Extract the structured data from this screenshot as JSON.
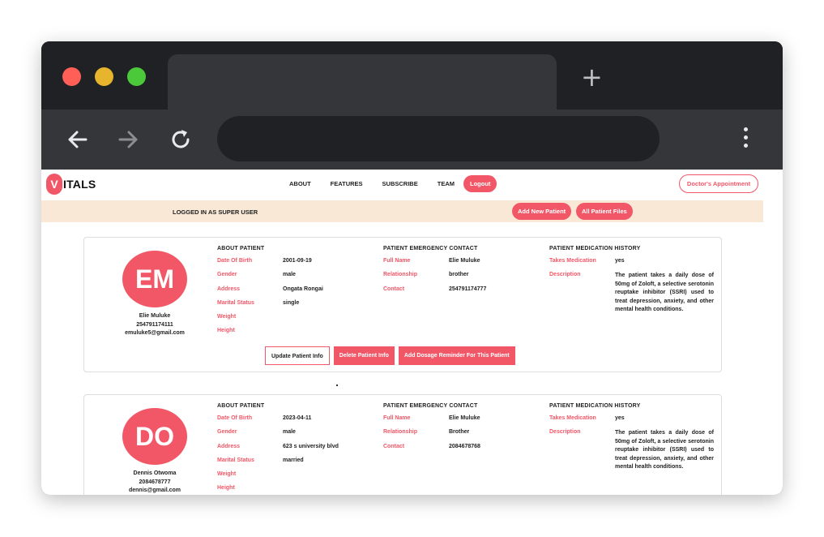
{
  "browser": {
    "new_tab_symbol": "+",
    "icons": [
      "back-arrow-icon",
      "forward-arrow-icon",
      "reload-icon",
      "more-vertical-icon"
    ]
  },
  "site": {
    "logo_initial": "V",
    "logo_rest": "ITALS",
    "nav": [
      "ABOUT",
      "FEATURES",
      "SUBSCRIBE",
      "TEAM"
    ],
    "logout_label": "Logout",
    "appointment_label": "Doctor's Appointment",
    "accent_color": "#f25767"
  },
  "admin_bar": {
    "status": "LOGGED IN AS SUPER USER",
    "add_patient_label": "Add New Patient",
    "all_files_label": "All Patient Files"
  },
  "headings": {
    "about": "ABOUT PATIENT",
    "emergency": "PATIENT EMERGENCY CONTACT",
    "medication": "PATIENT MEDICATION HISTORY"
  },
  "labels": {
    "dob": "Date Of Birth",
    "gender": "Gender",
    "address": "Address",
    "marital": "Marital Status",
    "weight": "Weight",
    "height": "Height",
    "full_name": "Full Name",
    "relationship": "Relationship",
    "contact": "Contact",
    "takes_med": "Takes Medication",
    "description": "Description"
  },
  "buttons": {
    "update": "Update Patient Info",
    "delete": "Delete Patient Info",
    "reminder": "Add Dosage Reminder For This Patient"
  },
  "patients": [
    {
      "initials": "EM",
      "name": "Elie Muluke",
      "phone": "254791174111",
      "email": "emuluke5@gmail.com",
      "dob": "2001-09-19",
      "gender": "male",
      "address": "Ongata Rongai",
      "marital": "single",
      "weight": "",
      "height": "",
      "ec_name": "Elie Muluke",
      "ec_relationship": "brother",
      "ec_contact": "254791174777",
      "takes_med": "yes",
      "description": "The patient takes a daily dose of 50mg of Zoloft, a selective serotonin reuptake inhibitor (SSRI) used to treat depression, anxiety, and other mental health conditions."
    },
    {
      "initials": "DO",
      "name": "Dennis Otwoma",
      "phone": "2084678777",
      "email": "dennis@gmail.com",
      "dob": "2023-04-11",
      "gender": "male",
      "address": "623 s university blvd",
      "marital": "married",
      "weight": "",
      "height": "",
      "ec_name": "Elie Muluke",
      "ec_relationship": "Brother",
      "ec_contact": "2084678768",
      "takes_med": "yes",
      "description": "The patient takes a daily dose of 50mg of Zoloft, a selective serotonin reuptake inhibitor (SSRI) used to treat depression, anxiety, and other mental health conditions."
    }
  ]
}
